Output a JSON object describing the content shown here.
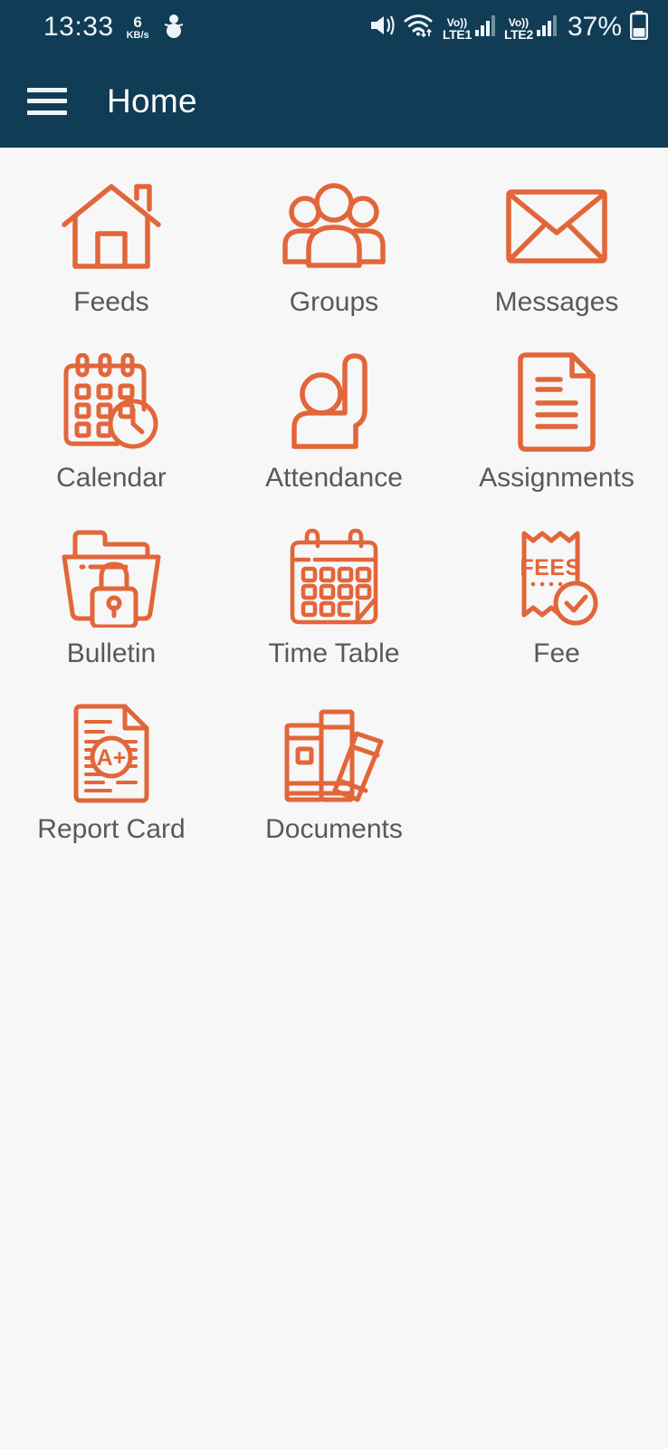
{
  "status_bar": {
    "time": "13:33",
    "net_speed_value": "6",
    "net_speed_unit": "KB/s",
    "icons": {
      "vibrate": "vibrate-mute-icon",
      "snowflake": "snowman-icon",
      "wifi": "wifi-icon",
      "battery": "battery-icon"
    },
    "sim1_volte_top": "Vo))",
    "sim1_volte_label": "LTE1",
    "sim2_volte_top": "Vo))",
    "sim2_volte_label": "LTE2",
    "battery_percent": "37%"
  },
  "app_bar": {
    "menu_icon": "hamburger-menu-icon",
    "title": "Home"
  },
  "theme": {
    "header_bg": "#103c56",
    "page_bg": "#f7f7f7",
    "icon_accent": "#e2663a",
    "label_color": "#58595b",
    "status_text": "#eef4f8"
  },
  "grid": {
    "tiles": [
      {
        "label": "Feeds",
        "icon": "house-icon"
      },
      {
        "label": "Groups",
        "icon": "people-group-icon"
      },
      {
        "label": "Messages",
        "icon": "envelope-icon"
      },
      {
        "label": "Calendar",
        "icon": "calendar-clock-icon"
      },
      {
        "label": "Attendance",
        "icon": "raised-hand-person-icon"
      },
      {
        "label": "Assignments",
        "icon": "document-lines-icon"
      },
      {
        "label": "Bulletin",
        "icon": "folder-lock-icon"
      },
      {
        "label": "Time Table",
        "icon": "calendar-grid-icon"
      },
      {
        "label": "Fee",
        "icon": "receipt-check-icon"
      },
      {
        "label": "Report Card",
        "icon": "report-card-aplus-icon"
      },
      {
        "label": "Documents",
        "icon": "books-icon"
      }
    ]
  }
}
